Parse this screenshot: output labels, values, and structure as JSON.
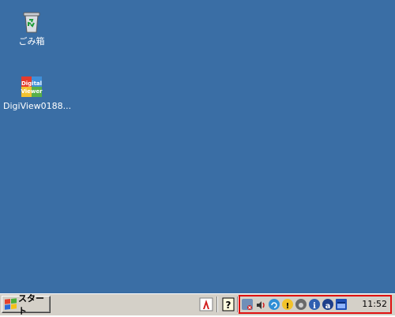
{
  "desktop": {
    "background": "#3a6ea5",
    "icons": [
      {
        "label": "ごみ箱",
        "icon": "recycle-bin-icon"
      },
      {
        "label": "DigiView0188...",
        "icon": "digital-viewer-icon"
      }
    ]
  },
  "taskbar": {
    "start_label": "スタート",
    "quick_launch": [
      {
        "icon": "acrobat-icon"
      },
      {
        "icon": "help-icon"
      }
    ],
    "tray": {
      "icons": [
        {
          "icon": "network-icon"
        },
        {
          "icon": "volume-icon"
        },
        {
          "icon": "refresh-icon"
        },
        {
          "icon": "security-shield-icon"
        },
        {
          "icon": "settings-icon"
        },
        {
          "icon": "info-icon"
        },
        {
          "icon": "atok-icon"
        },
        {
          "icon": "window-icon"
        }
      ],
      "clock": "11:52",
      "highlight_color": "#e01010"
    }
  }
}
